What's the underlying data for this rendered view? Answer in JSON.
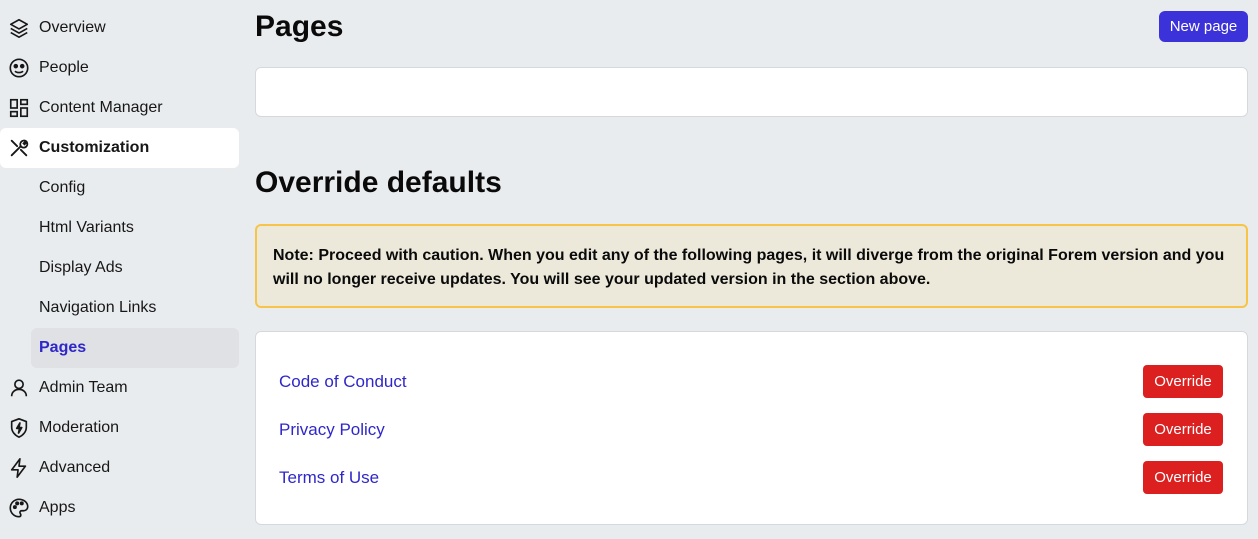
{
  "sidebar": {
    "items": [
      {
        "label": "Overview",
        "icon": "layers-icon"
      },
      {
        "label": "People",
        "icon": "people-icon"
      },
      {
        "label": "Content Manager",
        "icon": "grid-icon"
      },
      {
        "label": "Customization",
        "icon": "tools-icon"
      },
      {
        "label": "Admin Team",
        "icon": "user-icon"
      },
      {
        "label": "Moderation",
        "icon": "shield-icon"
      },
      {
        "label": "Advanced",
        "icon": "bolt-icon"
      },
      {
        "label": "Apps",
        "icon": "palette-icon"
      }
    ],
    "sub_items": [
      "Config",
      "Html Variants",
      "Display Ads",
      "Navigation Links",
      "Pages"
    ]
  },
  "main": {
    "title": "Pages",
    "new_page_label": "New page",
    "override_title": "Override defaults",
    "note": "Note: Proceed with caution. When you edit any of the following pages, it will diverge from the original Forem version and you will no longer receive updates. You will see your updated version in the section above.",
    "pages": [
      {
        "name": "Code of Conduct",
        "action": "Override"
      },
      {
        "name": "Privacy Policy",
        "action": "Override"
      },
      {
        "name": "Terms of Use",
        "action": "Override"
      }
    ]
  },
  "colors": {
    "accent": "#3b32d9",
    "link": "#2f27c9",
    "danger": "#dc2020",
    "warning_border": "#f7c447",
    "warning_bg": "#ece9db"
  }
}
